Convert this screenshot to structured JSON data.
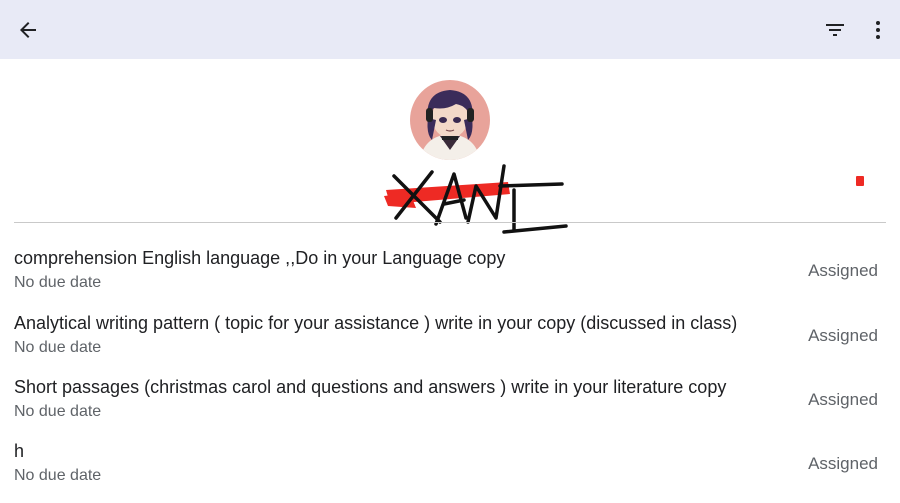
{
  "toolbar": {
    "back_icon": "arrow-back-icon",
    "filter_icon": "filter-icon",
    "more_icon": "more-vert-icon"
  },
  "colors": {
    "topbar_bg": "#e8eaf6",
    "scribble_red": "#ee2a24",
    "text_primary": "#202124",
    "text_secondary": "#5f6368"
  },
  "assignments": [
    {
      "title": "comprehension English language  ,,Do in your Language copy",
      "due": "No due date",
      "status": "Assigned"
    },
    {
      "title": "Analytical writing pattern  (  topic  for your assistance  )  write in your copy  (discussed in class)",
      "due": "No due date",
      "status": "Assigned"
    },
    {
      "title": "Short passages  (christmas carol and questions and answers  )  write in your  literature  copy",
      "due": "No due date",
      "status": "Assigned"
    },
    {
      "title": "h",
      "due": "No due date",
      "status": "Assigned"
    }
  ]
}
